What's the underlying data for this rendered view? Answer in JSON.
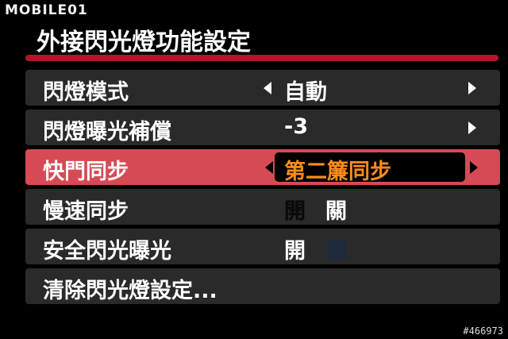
{
  "watermark": "MOBILE01",
  "title": "外接閃光燈功能設定",
  "menu": {
    "flash_mode": {
      "label": "閃燈模式",
      "value": "自動"
    },
    "flash_exposure_comp": {
      "label": "閃燈曝光補償",
      "value": "-3"
    },
    "shutter_sync": {
      "label": "快門同步",
      "value": "第二簾同步"
    },
    "slow_sync": {
      "label": "慢速同步",
      "option_on": "開",
      "option_off": "關",
      "selected": "關"
    },
    "safety_flash": {
      "label": "安全閃光曝光",
      "option_on": "開",
      "option_off": "關",
      "selected": "開"
    },
    "clear_settings": {
      "label": "清除閃光燈設定..."
    }
  },
  "image_number": "#466973",
  "colors": {
    "highlight_row": "#d64a55",
    "title_bar": "#b0172a",
    "selected_value": "#ff8c1a",
    "row_bg": "#2a2a2a"
  }
}
